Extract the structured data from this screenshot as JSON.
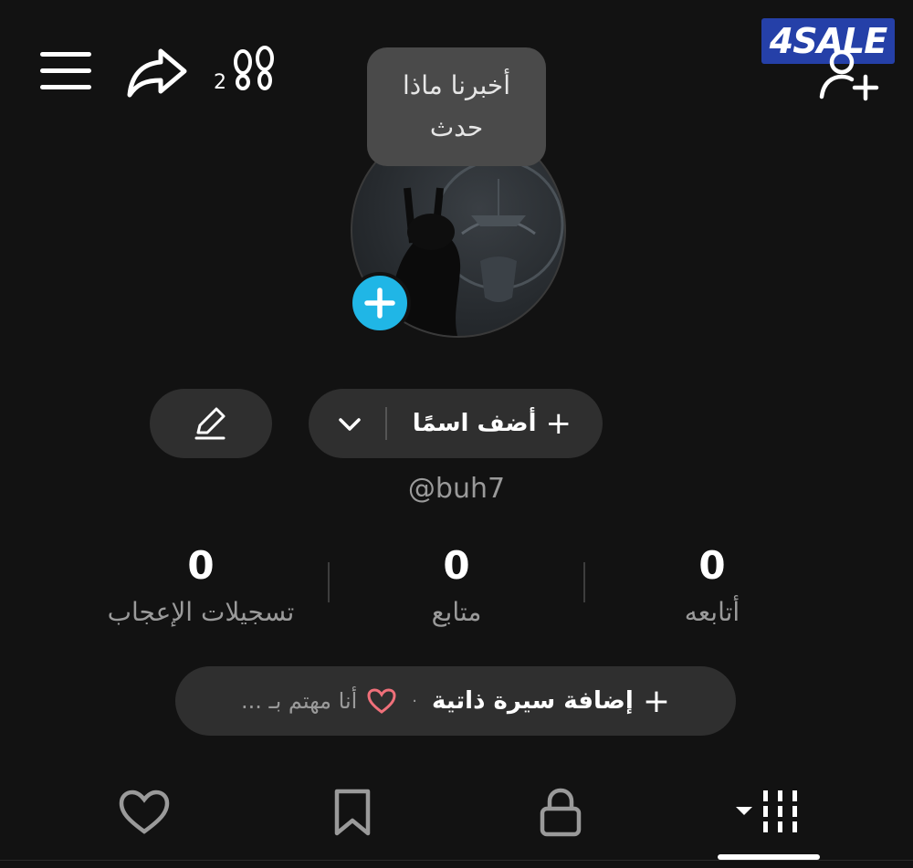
{
  "header": {
    "footprint_count": "2",
    "watermark_text": "4SALE",
    "watermark_color": "#2540a8"
  },
  "tooltip": {
    "text": "أخبرنا ماذا حدث"
  },
  "profile": {
    "add_name_label": "أضف اسمًا",
    "username": "@buh7",
    "avatar_badge_color": "#20b6e6"
  },
  "stats": {
    "following": {
      "value": "0",
      "label": "أتابعه"
    },
    "followers": {
      "value": "0",
      "label": "متابع"
    },
    "likes": {
      "value": "0",
      "label": "تسجيلات الإعجاب"
    }
  },
  "bio": {
    "add_label": "إضافة سيرة ذاتية",
    "separator": "·",
    "interest_text": "أنا مهتم بـ ..."
  },
  "tabs": [
    {
      "icon": "grid-videos-icon",
      "active": true
    },
    {
      "icon": "lock-icon",
      "active": false
    },
    {
      "icon": "bookmark-icon",
      "active": false
    },
    {
      "icon": "heart-icon",
      "active": false
    }
  ]
}
